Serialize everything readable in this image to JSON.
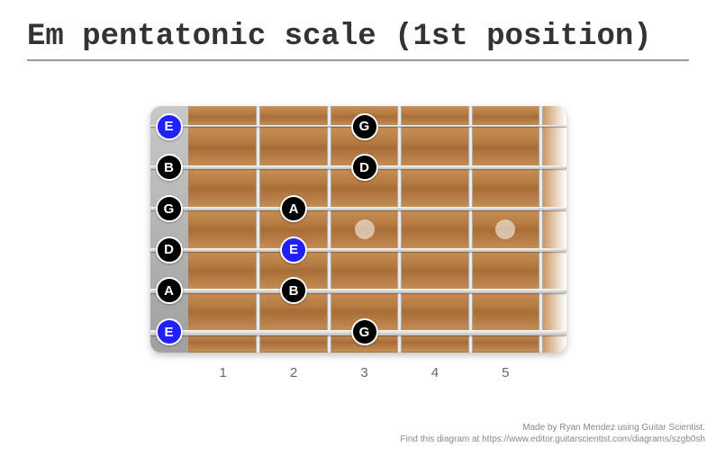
{
  "title": "Em pentatonic scale (1st position)",
  "fretboard": {
    "num_frets": 5,
    "fret_labels": [
      "1",
      "2",
      "3",
      "4",
      "5"
    ]
  },
  "inlays": [
    {
      "fret": 3,
      "between_strings": [
        3,
        4
      ]
    },
    {
      "fret": 5,
      "between_strings": [
        3,
        4
      ]
    }
  ],
  "notes": [
    {
      "string": 1,
      "fret": 0,
      "label": "E",
      "color": "blue"
    },
    {
      "string": 1,
      "fret": 3,
      "label": "G",
      "color": "black"
    },
    {
      "string": 2,
      "fret": 0,
      "label": "B",
      "color": "black"
    },
    {
      "string": 2,
      "fret": 3,
      "label": "D",
      "color": "black"
    },
    {
      "string": 3,
      "fret": 0,
      "label": "G",
      "color": "black"
    },
    {
      "string": 3,
      "fret": 2,
      "label": "A",
      "color": "black"
    },
    {
      "string": 4,
      "fret": 0,
      "label": "D",
      "color": "black"
    },
    {
      "string": 4,
      "fret": 2,
      "label": "E",
      "color": "blue"
    },
    {
      "string": 5,
      "fret": 0,
      "label": "A",
      "color": "black"
    },
    {
      "string": 5,
      "fret": 2,
      "label": "B",
      "color": "black"
    },
    {
      "string": 6,
      "fret": 0,
      "label": "E",
      "color": "blue"
    },
    {
      "string": 6,
      "fret": 3,
      "label": "G",
      "color": "black"
    }
  ],
  "attribution": {
    "line1": "Made by Ryan Mendez using Guitar Scientist.",
    "line2": "Find this diagram at https://www.editor.guitarscientist.com/diagrams/szgb0sh"
  }
}
